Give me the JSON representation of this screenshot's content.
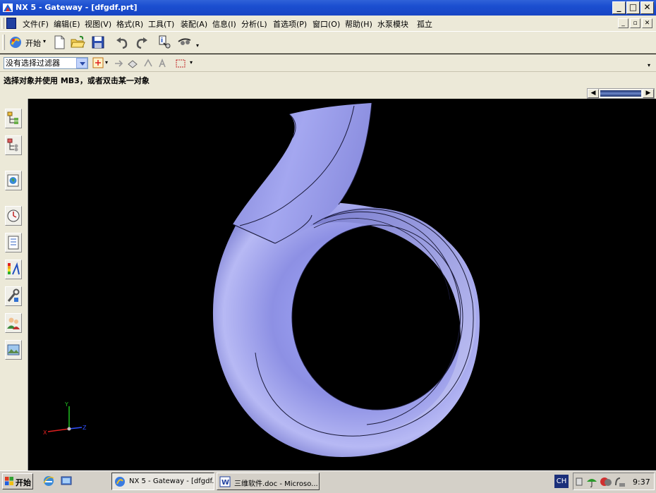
{
  "window": {
    "title": "NX 5 - Gateway - [dfgdf.prt]"
  },
  "menu": {
    "items": [
      "文件(F)",
      "编辑(E)",
      "视图(V)",
      "格式(R)",
      "工具(T)",
      "装配(A)",
      "信息(I)",
      "分析(L)",
      "首选项(P)",
      "窗口(O)",
      "帮助(H)",
      "水泵模块",
      "孤立"
    ]
  },
  "toolbar": {
    "start_label": "开始"
  },
  "filter": {
    "value": "没有选择过滤器"
  },
  "cue": {
    "text": "选择对象并使用 MB3，或者双击某一对象"
  },
  "triad": {
    "x": "X",
    "y": "Y",
    "z": "Z"
  },
  "taskbar": {
    "start_label": "开始",
    "tasks": [
      "NX 5 - Gateway - [dfgdf...",
      "三维软件.doc - Microso..."
    ],
    "lang": "CH",
    "clock": "9:37"
  },
  "colors": {
    "model_fill": "#8f91e0",
    "model_highlight": "#c8c9f6",
    "viewport_bg": "#000000",
    "titlebar": "#1b4ed0"
  },
  "icons": [
    "app-icon",
    "new-file-icon",
    "open-folder-icon",
    "save-icon",
    "undo-icon",
    "redo-icon",
    "clock-icon",
    "windows-logo-icon"
  ]
}
